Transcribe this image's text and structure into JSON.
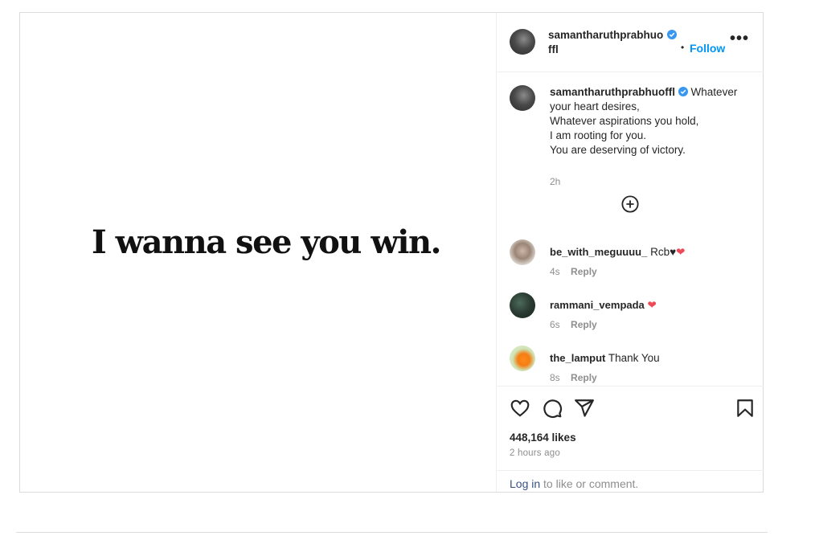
{
  "post": {
    "media_text": "I wanna see you win.",
    "header": {
      "username_line1": "samantharuthprabhuo",
      "username_line2": "ffl",
      "follow_label": "Follow",
      "separator": "•",
      "more_label": "•••"
    },
    "caption": {
      "username": "samantharuthprabhuoffl",
      "text_first": "Whatever",
      "lines": [
        "your heart desires,",
        "Whatever aspirations you hold,",
        "I am rooting for you.",
        "You are deserving of victory."
      ],
      "time": "2h"
    },
    "comments": [
      {
        "username": "be_with_meguuuu_",
        "text": "Rcb♥",
        "emoji": "❤",
        "time": "4s",
        "reply": "Reply"
      },
      {
        "username": "rammani_vempada",
        "text": "",
        "emoji": "❤",
        "time": "6s",
        "reply": "Reply"
      },
      {
        "username": "the_lamput",
        "text": "Thank You",
        "emoji": "",
        "time": "8s",
        "reply": "Reply"
      }
    ],
    "likes": "448,164 likes",
    "posted_ago": "2 hours ago",
    "login": {
      "link": "Log in",
      "rest": "to like or comment."
    }
  },
  "colors": {
    "accent": "#0095f6",
    "verified": "#3897f0",
    "heart": "#ed4956",
    "link": "#385185"
  },
  "icons": [
    "heart-icon",
    "comment-icon",
    "share-icon",
    "bookmark-icon",
    "add-circle-icon",
    "verified-badge-icon",
    "more-options-icon"
  ]
}
